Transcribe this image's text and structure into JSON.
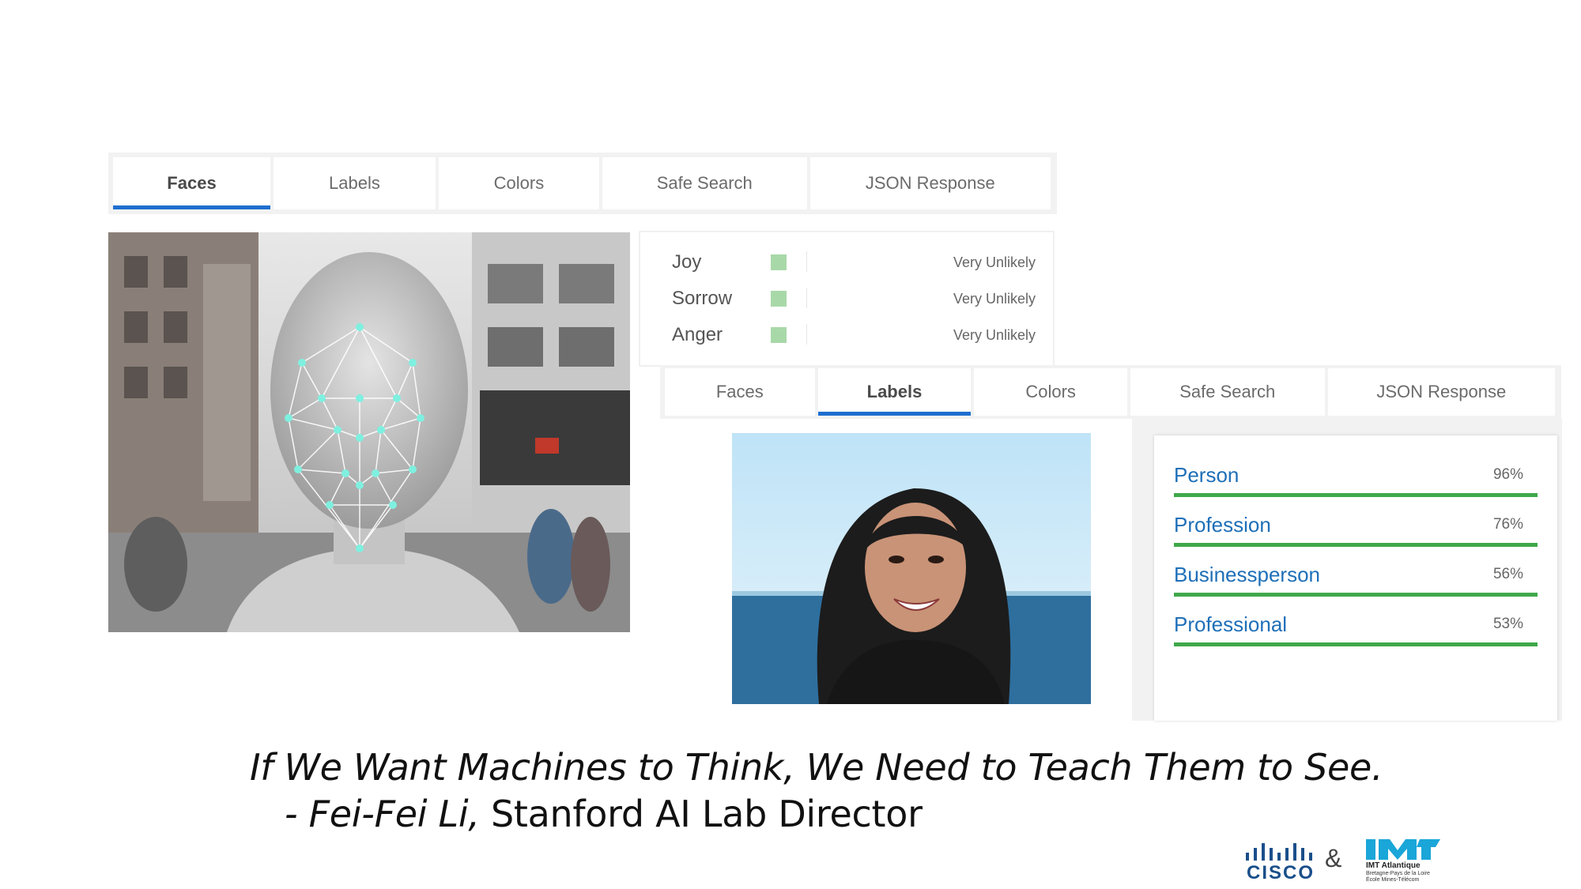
{
  "panel_faces": {
    "tabs": [
      {
        "label": "Faces",
        "active": true
      },
      {
        "label": "Labels",
        "active": false
      },
      {
        "label": "Colors",
        "active": false
      },
      {
        "label": "Safe Search",
        "active": false
      },
      {
        "label": "JSON Response",
        "active": false
      }
    ],
    "emotions": [
      {
        "label": "Joy",
        "value": "Very Unlikely"
      },
      {
        "label": "Sorrow",
        "value": "Very Unlikely"
      },
      {
        "label": "Anger",
        "value": "Very Unlikely"
      }
    ]
  },
  "panel_labels": {
    "tabs": [
      {
        "label": "Faces",
        "active": false
      },
      {
        "label": "Labels",
        "active": true
      },
      {
        "label": "Colors",
        "active": false
      },
      {
        "label": "Safe Search",
        "active": false
      },
      {
        "label": "JSON Response",
        "active": false
      }
    ],
    "labels": [
      {
        "name": "Person",
        "score": "96%",
        "fraction": 1.0
      },
      {
        "name": "Profession",
        "score": "76%",
        "fraction": 1.0
      },
      {
        "name": "Businessperson",
        "score": "56%",
        "fraction": 1.0
      },
      {
        "name": "Professional",
        "score": "53%",
        "fraction": 1.0
      }
    ]
  },
  "quote": {
    "line1": "If We Want Machines to Think, We Need to Teach Them to See.",
    "dash": "- ",
    "author": "Fei-Fei Li,",
    "role": " Stanford AI Lab Director"
  },
  "logos": {
    "cisco": "CISCO",
    "ampersand": "&",
    "imt_name": "IMT Atlantique",
    "imt_line1": "Bretagne-Pays de la Loire",
    "imt_line2": "École Mines-Télécom"
  },
  "colors": {
    "tab_active_underline": "#1e6fcf",
    "label_bar": "#3fa84a",
    "label_text": "#1e6fb8",
    "emotion_box": "#a8d8a8"
  },
  "icons": [
    "face-mesh-photo",
    "portrait-photo",
    "cisco-logo",
    "imt-logo"
  ]
}
